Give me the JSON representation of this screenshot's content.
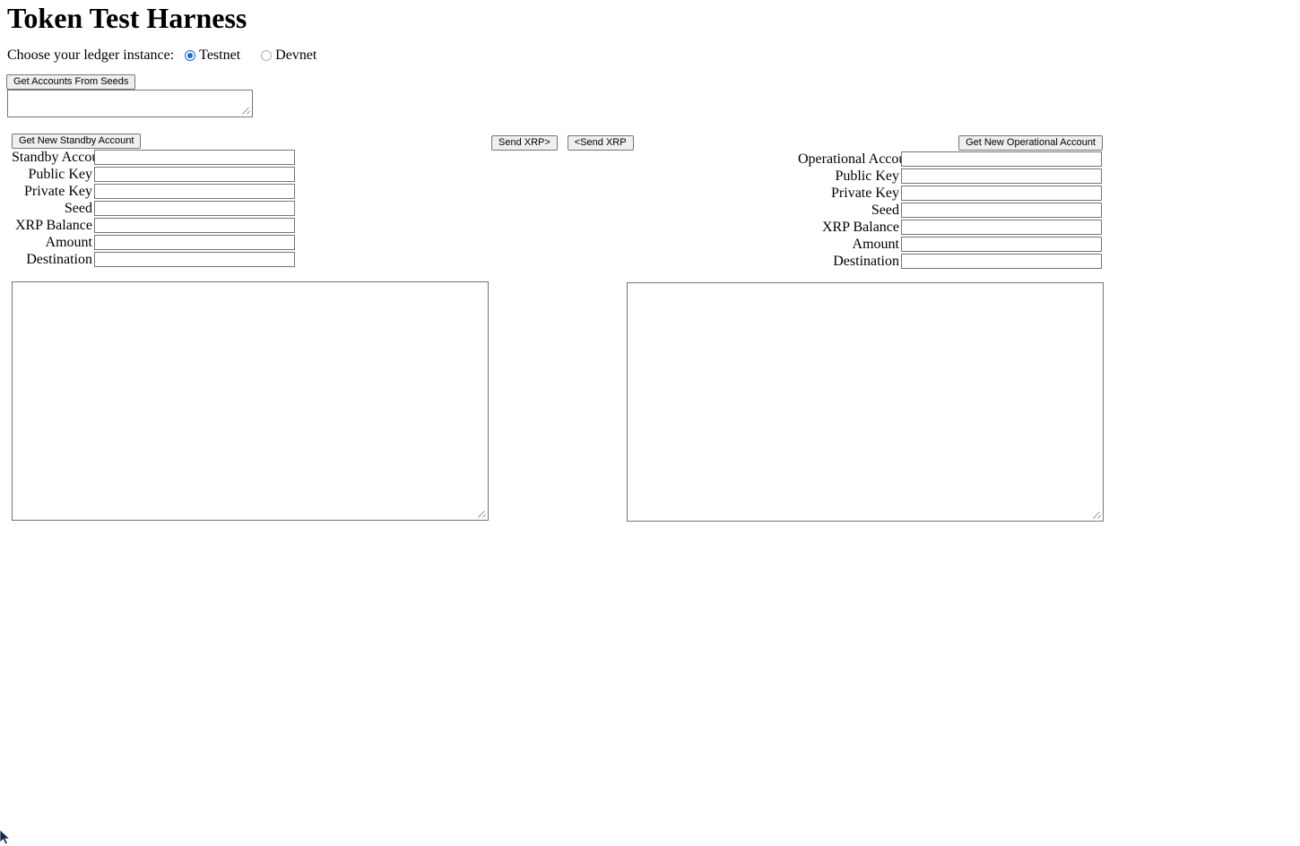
{
  "page": {
    "title": "Token Test Harness"
  },
  "ledger": {
    "prompt": "Choose your ledger instance:",
    "options": [
      {
        "label": "Testnet",
        "selected": true
      },
      {
        "label": "Devnet",
        "selected": false
      }
    ]
  },
  "seeds": {
    "button_label": "Get Accounts From Seeds",
    "textarea_value": "",
    "textarea_placeholder": ""
  },
  "standby": {
    "button_label": "Get New Standby Account",
    "fields": [
      {
        "label": "Standby Account",
        "value": ""
      },
      {
        "label": "Public Key",
        "value": ""
      },
      {
        "label": "Private Key",
        "value": ""
      },
      {
        "label": "Seed",
        "value": ""
      },
      {
        "label": "XRP Balance",
        "value": ""
      },
      {
        "label": "Amount",
        "value": ""
      },
      {
        "label": "Destination",
        "value": ""
      }
    ],
    "results_value": ""
  },
  "operational": {
    "button_label": "Get New Operational Account",
    "fields": [
      {
        "label": "Operational Account",
        "value": ""
      },
      {
        "label": "Public Key",
        "value": ""
      },
      {
        "label": "Private Key",
        "value": ""
      },
      {
        "label": "Seed",
        "value": ""
      },
      {
        "label": "XRP Balance",
        "value": ""
      },
      {
        "label": "Amount",
        "value": ""
      },
      {
        "label": "Destination",
        "value": ""
      }
    ],
    "results_value": ""
  },
  "transfer": {
    "send_right_label": "Send XRP>",
    "send_left_label": "<Send XRP"
  },
  "colors": {
    "accent_radio": "#1266f1",
    "button_face": "#efefef",
    "control_border": "#767676",
    "page_background": "#ffffff",
    "text": "#000000"
  }
}
